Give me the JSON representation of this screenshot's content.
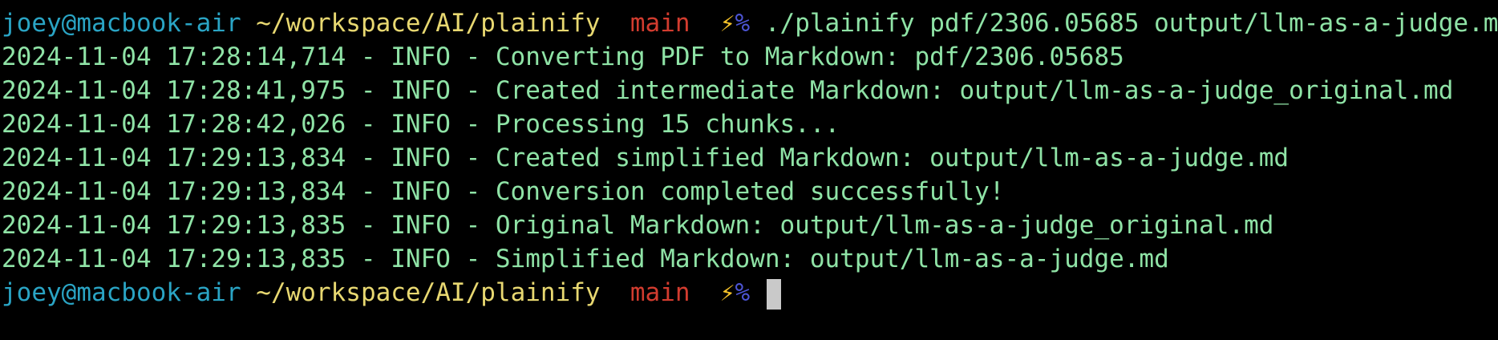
{
  "prompt": {
    "user_host": "joey@macbook-air",
    "cwd": "~/workspace/AI/plainify",
    "branch": "main",
    "bolt": "⚡",
    "symbol": "%"
  },
  "command": "./plainify pdf/2306.05685 output/llm-as-a-judge.md",
  "log_lines": [
    "2024-11-04 17:28:14,714 - INFO - Converting PDF to Markdown: pdf/2306.05685",
    "2024-11-04 17:28:41,975 - INFO - Created intermediate Markdown: output/llm-as-a-judge_original.md",
    "2024-11-04 17:28:42,026 - INFO - Processing 15 chunks...",
    "2024-11-04 17:29:13,834 - INFO - Created simplified Markdown: output/llm-as-a-judge.md",
    "2024-11-04 17:29:13,834 - INFO - Conversion completed successfully!",
    "2024-11-04 17:29:13,835 - INFO - Original Markdown: output/llm-as-a-judge_original.md",
    "2024-11-04 17:29:13,835 - INFO - Simplified Markdown: output/llm-as-a-judge.md"
  ],
  "colors": {
    "background": "#000000",
    "user_host": "#2aa4c4",
    "cwd": "#e8d871",
    "branch": "#d23c2f",
    "symbol": "#4d55d6",
    "output_text": "#8fe3a6",
    "cursor": "#c9c9c9"
  }
}
